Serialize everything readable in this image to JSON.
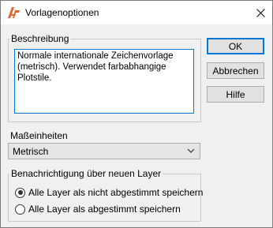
{
  "window": {
    "title": "Vorlagenoptionen"
  },
  "description": {
    "group_label": "Beschreibung",
    "text": "Normale internationale Zeichenvorlage\n(metrisch). Verwendet farbabhangige Plotstile."
  },
  "buttons": {
    "ok": "OK",
    "cancel": "Abbrechen",
    "help": "Hilfe"
  },
  "units": {
    "label": "Maßeinheiten",
    "selected": "Metrisch"
  },
  "layer_notification": {
    "group_label": "Benachrichtigung über neuen Layer",
    "options": [
      {
        "label": "Alle Layer als nicht abgestimmt speichern",
        "checked": true
      },
      {
        "label": "Alle Layer als abgestimmt speichern",
        "checked": false
      }
    ]
  },
  "colors": {
    "accent": "#0078d7",
    "app_icon": "#e8612c"
  },
  "icons": {
    "app": "autocad-icon",
    "close": "close-icon",
    "dropdown": "chevron-down-icon"
  }
}
